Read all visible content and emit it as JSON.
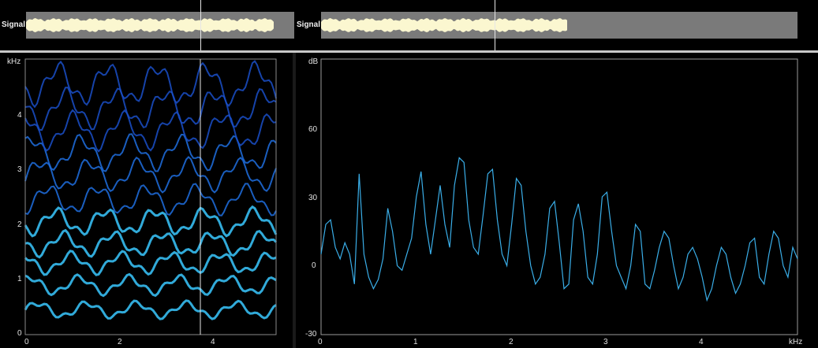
{
  "left_signal": {
    "label": "Signal"
  },
  "right_signal": {
    "label": "Signal"
  },
  "chart_data": [
    {
      "type": "heatmap",
      "title": "",
      "ylabel": "kHz",
      "xlabel": "",
      "x_ticks": [
        "0",
        "2",
        "4"
      ],
      "y_ticks": [
        "0",
        "1",
        "2",
        "3",
        "4"
      ],
      "xlim": [
        0,
        5.3
      ],
      "ylim": [
        0,
        5
      ],
      "cursor_x": 3.7,
      "colorscale": [
        "#000000",
        "#0a2a8c",
        "#1f6fe0",
        "#3ac8ff"
      ],
      "harmonic_tracks": [
        0.45,
        0.9,
        1.3,
        1.65,
        2.05,
        2.45,
        2.9,
        3.3,
        3.7,
        4.1,
        4.55
      ]
    },
    {
      "type": "line",
      "title": "",
      "xlabel": "kHz",
      "ylabel": "dB",
      "x_ticks": [
        "0",
        "1",
        "2",
        "3",
        "4"
      ],
      "y_ticks": [
        "-30",
        "0",
        "30",
        "60"
      ],
      "xlim": [
        0,
        5
      ],
      "ylim": [
        -30,
        90
      ],
      "series": [
        {
          "color": "#3aaee8",
          "x": [
            0,
            0.05,
            0.1,
            0.15,
            0.2,
            0.25,
            0.3,
            0.35,
            0.4,
            0.45,
            0.5,
            0.55,
            0.6,
            0.65,
            0.7,
            0.75,
            0.8,
            0.85,
            0.9,
            0.95,
            1.0,
            1.05,
            1.1,
            1.15,
            1.2,
            1.25,
            1.3,
            1.35,
            1.4,
            1.45,
            1.5,
            1.55,
            1.6,
            1.65,
            1.7,
            1.75,
            1.8,
            1.85,
            1.9,
            1.95,
            2.0,
            2.05,
            2.1,
            2.15,
            2.2,
            2.25,
            2.3,
            2.35,
            2.4,
            2.45,
            2.5,
            2.55,
            2.6,
            2.65,
            2.7,
            2.75,
            2.8,
            2.85,
            2.9,
            2.95,
            3.0,
            3.05,
            3.1,
            3.15,
            3.2,
            3.25,
            3.3,
            3.35,
            3.4,
            3.45,
            3.5,
            3.55,
            3.6,
            3.65,
            3.7,
            3.75,
            3.8,
            3.85,
            3.9,
            3.95,
            4.0,
            4.05,
            4.1,
            4.15,
            4.2,
            4.25,
            4.3,
            4.35,
            4.4,
            4.45,
            4.5,
            4.55,
            4.6,
            4.65,
            4.7,
            4.75,
            4.8,
            4.85,
            4.9,
            4.95,
            5.0
          ],
          "y": [
            5,
            18,
            20,
            8,
            3,
            10,
            5,
            -8,
            40,
            5,
            -5,
            -10,
            -6,
            3,
            25,
            15,
            0,
            -2,
            5,
            12,
            30,
            41,
            18,
            5,
            20,
            35,
            18,
            8,
            35,
            47,
            45,
            20,
            8,
            5,
            22,
            40,
            42,
            20,
            5,
            0,
            18,
            38,
            35,
            15,
            0,
            -8,
            -5,
            5,
            25,
            28,
            10,
            -10,
            -8,
            20,
            27,
            15,
            -5,
            -8,
            5,
            30,
            32,
            15,
            0,
            -5,
            -10,
            0,
            18,
            15,
            -8,
            -10,
            -2,
            8,
            15,
            12,
            0,
            -10,
            -5,
            5,
            8,
            3,
            -5,
            -15,
            -10,
            0,
            8,
            5,
            -5,
            -12,
            -8,
            0,
            10,
            12,
            -5,
            -8,
            5,
            15,
            12,
            0,
            -5,
            8,
            3
          ]
        }
      ]
    }
  ]
}
